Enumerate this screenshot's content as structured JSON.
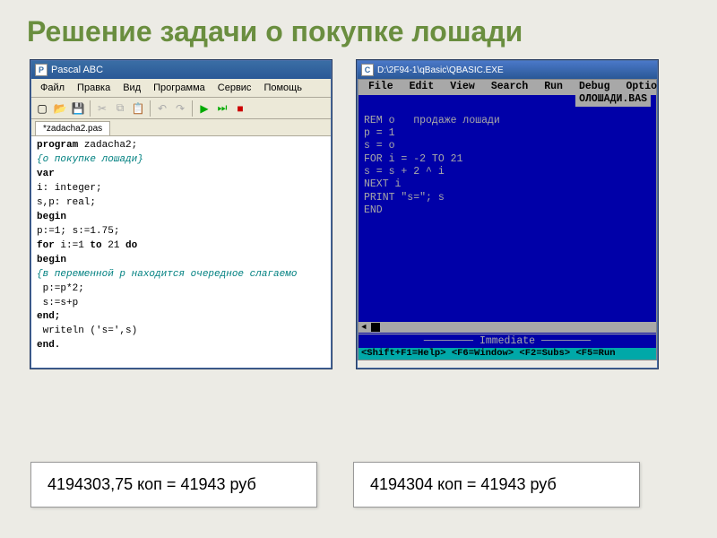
{
  "slide_title": "Решение задачи о покупке лошади",
  "pascal": {
    "window_title": "Pascal ABC",
    "icon_text": "P",
    "menu": [
      "Файл",
      "Правка",
      "Вид",
      "Программа",
      "Сервис",
      "Помощь"
    ],
    "tab": "*zadacha2.pas",
    "code": {
      "l1_kw1": "program",
      "l1_rest": " zadacha2;",
      "l2": "{о покупке лошади}",
      "l3": "var",
      "l4": "i: integer;",
      "l5": "s,p: real;",
      "l6": "begin",
      "l7": "p:=1; s:=1.75;",
      "l8_kw1": "for",
      "l8_mid": " i:=1 ",
      "l8_kw2": "to",
      "l8_mid2": " 21 ",
      "l8_kw3": "do",
      "l9": "begin",
      "l10": "{в пеpеменной p находится очеpедное слагаемо",
      "l11": " p:=p*2;",
      "l12": " s:=s+p",
      "l13": "end;",
      "l14": " writeln ('s=',s)",
      "l15": "end."
    }
  },
  "qbasic": {
    "window_title": "D:\\2F94-1\\qBasic\\QBASIC.EXE",
    "menu": [
      "File",
      "Edit",
      "View",
      "Search",
      "Run",
      "Debug",
      "Optio"
    ],
    "filename": "ОЛОШАДИ.BAS",
    "code_lines": [
      "REM о   продаже лошади",
      "p = 1",
      "s = o",
      "FOR i = -2 TO 21",
      "s = s + 2 ^ i",
      "NEXT i",
      "PRINT \"s=\"; s",
      "END"
    ],
    "immediate_label": "Immediate",
    "status": " <Shift+F1=Help> <F6=Window> <F2=Subs> <F5=Run"
  },
  "results": {
    "pascal": "4194303,75 коп = 41943 руб",
    "qbasic": "4194304 коп = 41943 руб"
  }
}
